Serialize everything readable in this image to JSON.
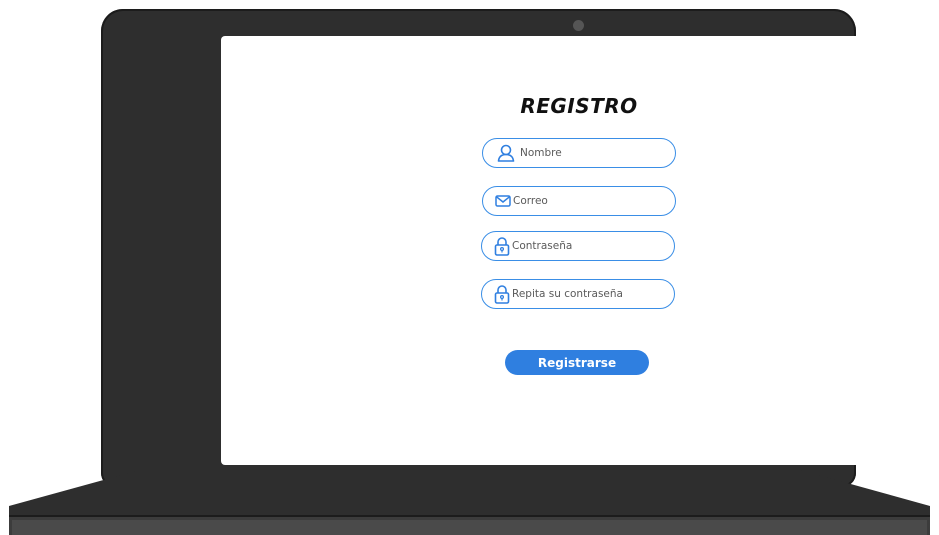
{
  "form": {
    "title": "REGISTRO",
    "fields": [
      {
        "placeholder": "Nombre",
        "icon": "user-icon"
      },
      {
        "placeholder": "Correo",
        "icon": "envelope-icon"
      },
      {
        "placeholder": "Contraseña",
        "icon": "lock-icon"
      },
      {
        "placeholder": "Repita su contraseña",
        "icon": "lock-icon"
      }
    ],
    "submit_label": "Registrarse"
  },
  "colors": {
    "accent": "#2f7fe0",
    "field_border": "#3a8ee6",
    "laptop_body": "#2e2e2e",
    "screen": "#ffffff"
  }
}
